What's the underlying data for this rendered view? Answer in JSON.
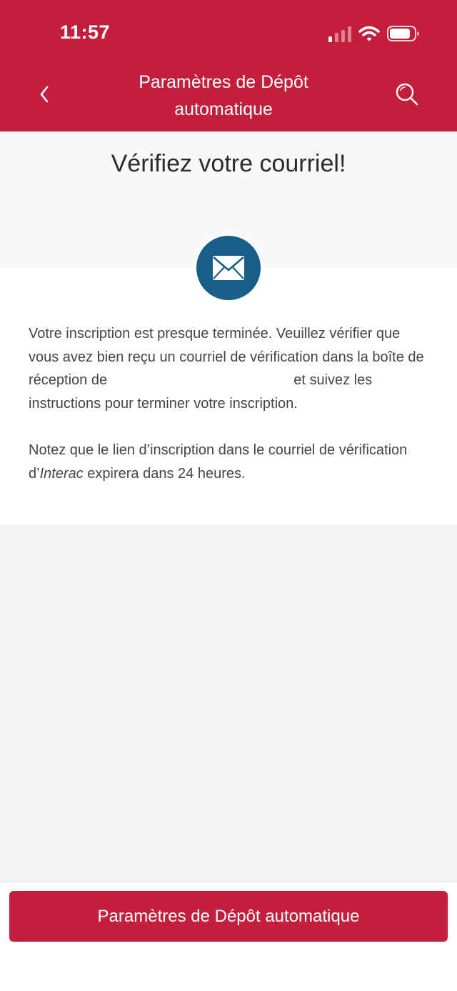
{
  "status_bar": {
    "time": "11:57"
  },
  "header": {
    "title": "Paramètres de Dépôt automatique",
    "back_icon": "chevron-left-icon",
    "search_icon": "search-icon"
  },
  "hero": {
    "title": "Vérifiez votre courriel!",
    "icon": "envelope-icon"
  },
  "body": {
    "paragraph1_part1": "Votre inscription est presque terminée. Veuillez vérifier que vous avez bien reçu un courriel de vérification dans la boîte de réception de",
    "paragraph1_part2": "et suivez les instructions pour terminer votre inscription.",
    "paragraph2_part1": "Notez que le lien d’inscription dans le courriel de vérification d’",
    "paragraph2_brand": "Interac",
    "paragraph2_part2": " expirera dans 24 heures."
  },
  "footer": {
    "button_label": "Paramètres de Dépôt automatique"
  },
  "colors": {
    "brand_red": "#c41e3d",
    "icon_blue": "#175f8a",
    "background": "#f3f3f4"
  }
}
